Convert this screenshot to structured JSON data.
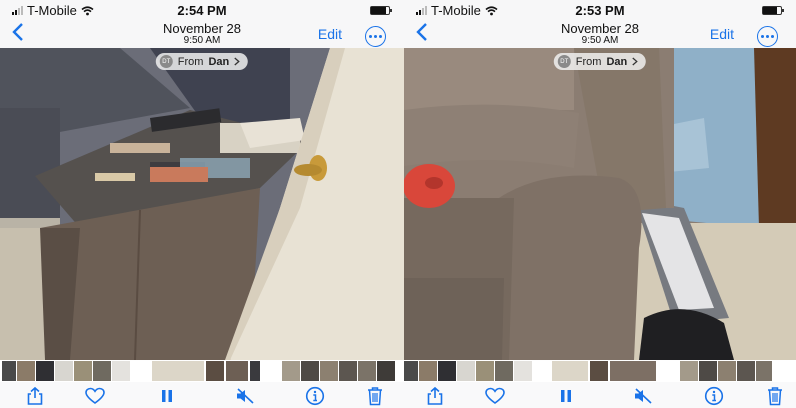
{
  "left": {
    "status": {
      "carrier": "T-Mobile",
      "time": "2:54 PM",
      "battery_level": 0.85
    },
    "nav": {
      "back_icon": "chevron-left-icon",
      "date": "November 28",
      "time": "9:50 AM",
      "edit_label": "Edit",
      "more_icon": "ellipsis-circle-icon"
    },
    "shared_from": {
      "avatar_initials": "DT",
      "prefix": "From ",
      "name": "Dan"
    },
    "toolbar": [
      "share-icon",
      "heart-icon",
      "pause-icon",
      "mute-icon",
      "info-icon",
      "trash-icon"
    ]
  },
  "right": {
    "status": {
      "carrier": "T-Mobile",
      "time": "2:53 PM",
      "battery_level": 0.8
    },
    "nav": {
      "back_icon": "chevron-left-icon",
      "date": "November 28",
      "time": "9:50 AM",
      "edit_label": "Edit",
      "more_icon": "ellipsis-circle-icon"
    },
    "shared_from": {
      "avatar_initials": "DT",
      "prefix": "From ",
      "name": "Dan"
    },
    "toolbar": [
      "share-icon",
      "heart-icon",
      "pause-icon",
      "mute-icon",
      "info-icon",
      "trash-icon"
    ]
  },
  "colors": {
    "accent": "#1a73e8"
  }
}
